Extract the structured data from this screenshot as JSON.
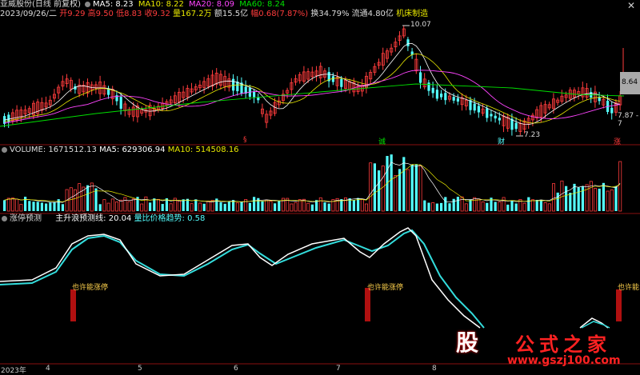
{
  "header": {
    "stock": "亚威股份(日线 前复权)",
    "ma5": "MA5: 8.23",
    "ma10": "MA10: 8.22",
    "ma20": "MA20: 8.09",
    "ma60": "MA60: 8.24",
    "date": "2023/09/26/二",
    "open": "开9.29",
    "high": "高9.50",
    "low": "低8.83",
    "close": "收9.32",
    "volume": "量167.2万",
    "amount": "额15.5亿",
    "amplitude": "幅0.68(7.87%)",
    "turnover": "换34.79%",
    "float": "流通4.80亿",
    "sector": "机床制造"
  },
  "price_labels": {
    "high": "10.07",
    "low": "7.23",
    "right_price": "8.64",
    "right_range": "7.87 - 7"
  },
  "markers": {
    "s1": "§",
    "m_cheng": "诚",
    "m_cai": "财",
    "m_zhang": "涨"
  },
  "volume_header": {
    "title": "VOLUME: 1671512.13",
    "ma5": "MA5: 629306.94",
    "ma10": "MA10: 514508.16"
  },
  "indicator_header": {
    "title": "涨停预测",
    "line1": "主升浪预测线: 20.04",
    "line2": "量比价格趋势: 0.58"
  },
  "signals": [
    "也许能涨停",
    "也许能涨停",
    "也许能"
  ],
  "axis": {
    "year": "2023年",
    "m4": "4",
    "m5": "5",
    "m6": "6",
    "m7": "7",
    "m8": "8"
  },
  "watermark": {
    "glyph": "股",
    "brand": "公式之家",
    "url": "www.gszj100.com"
  },
  "colors": {
    "up": "#ff3c3c",
    "down": "#54ffff",
    "ma5": "#ffffff",
    "ma10": "#e8e800",
    "ma20": "#ff44ff",
    "ma60": "#00e000"
  }
}
